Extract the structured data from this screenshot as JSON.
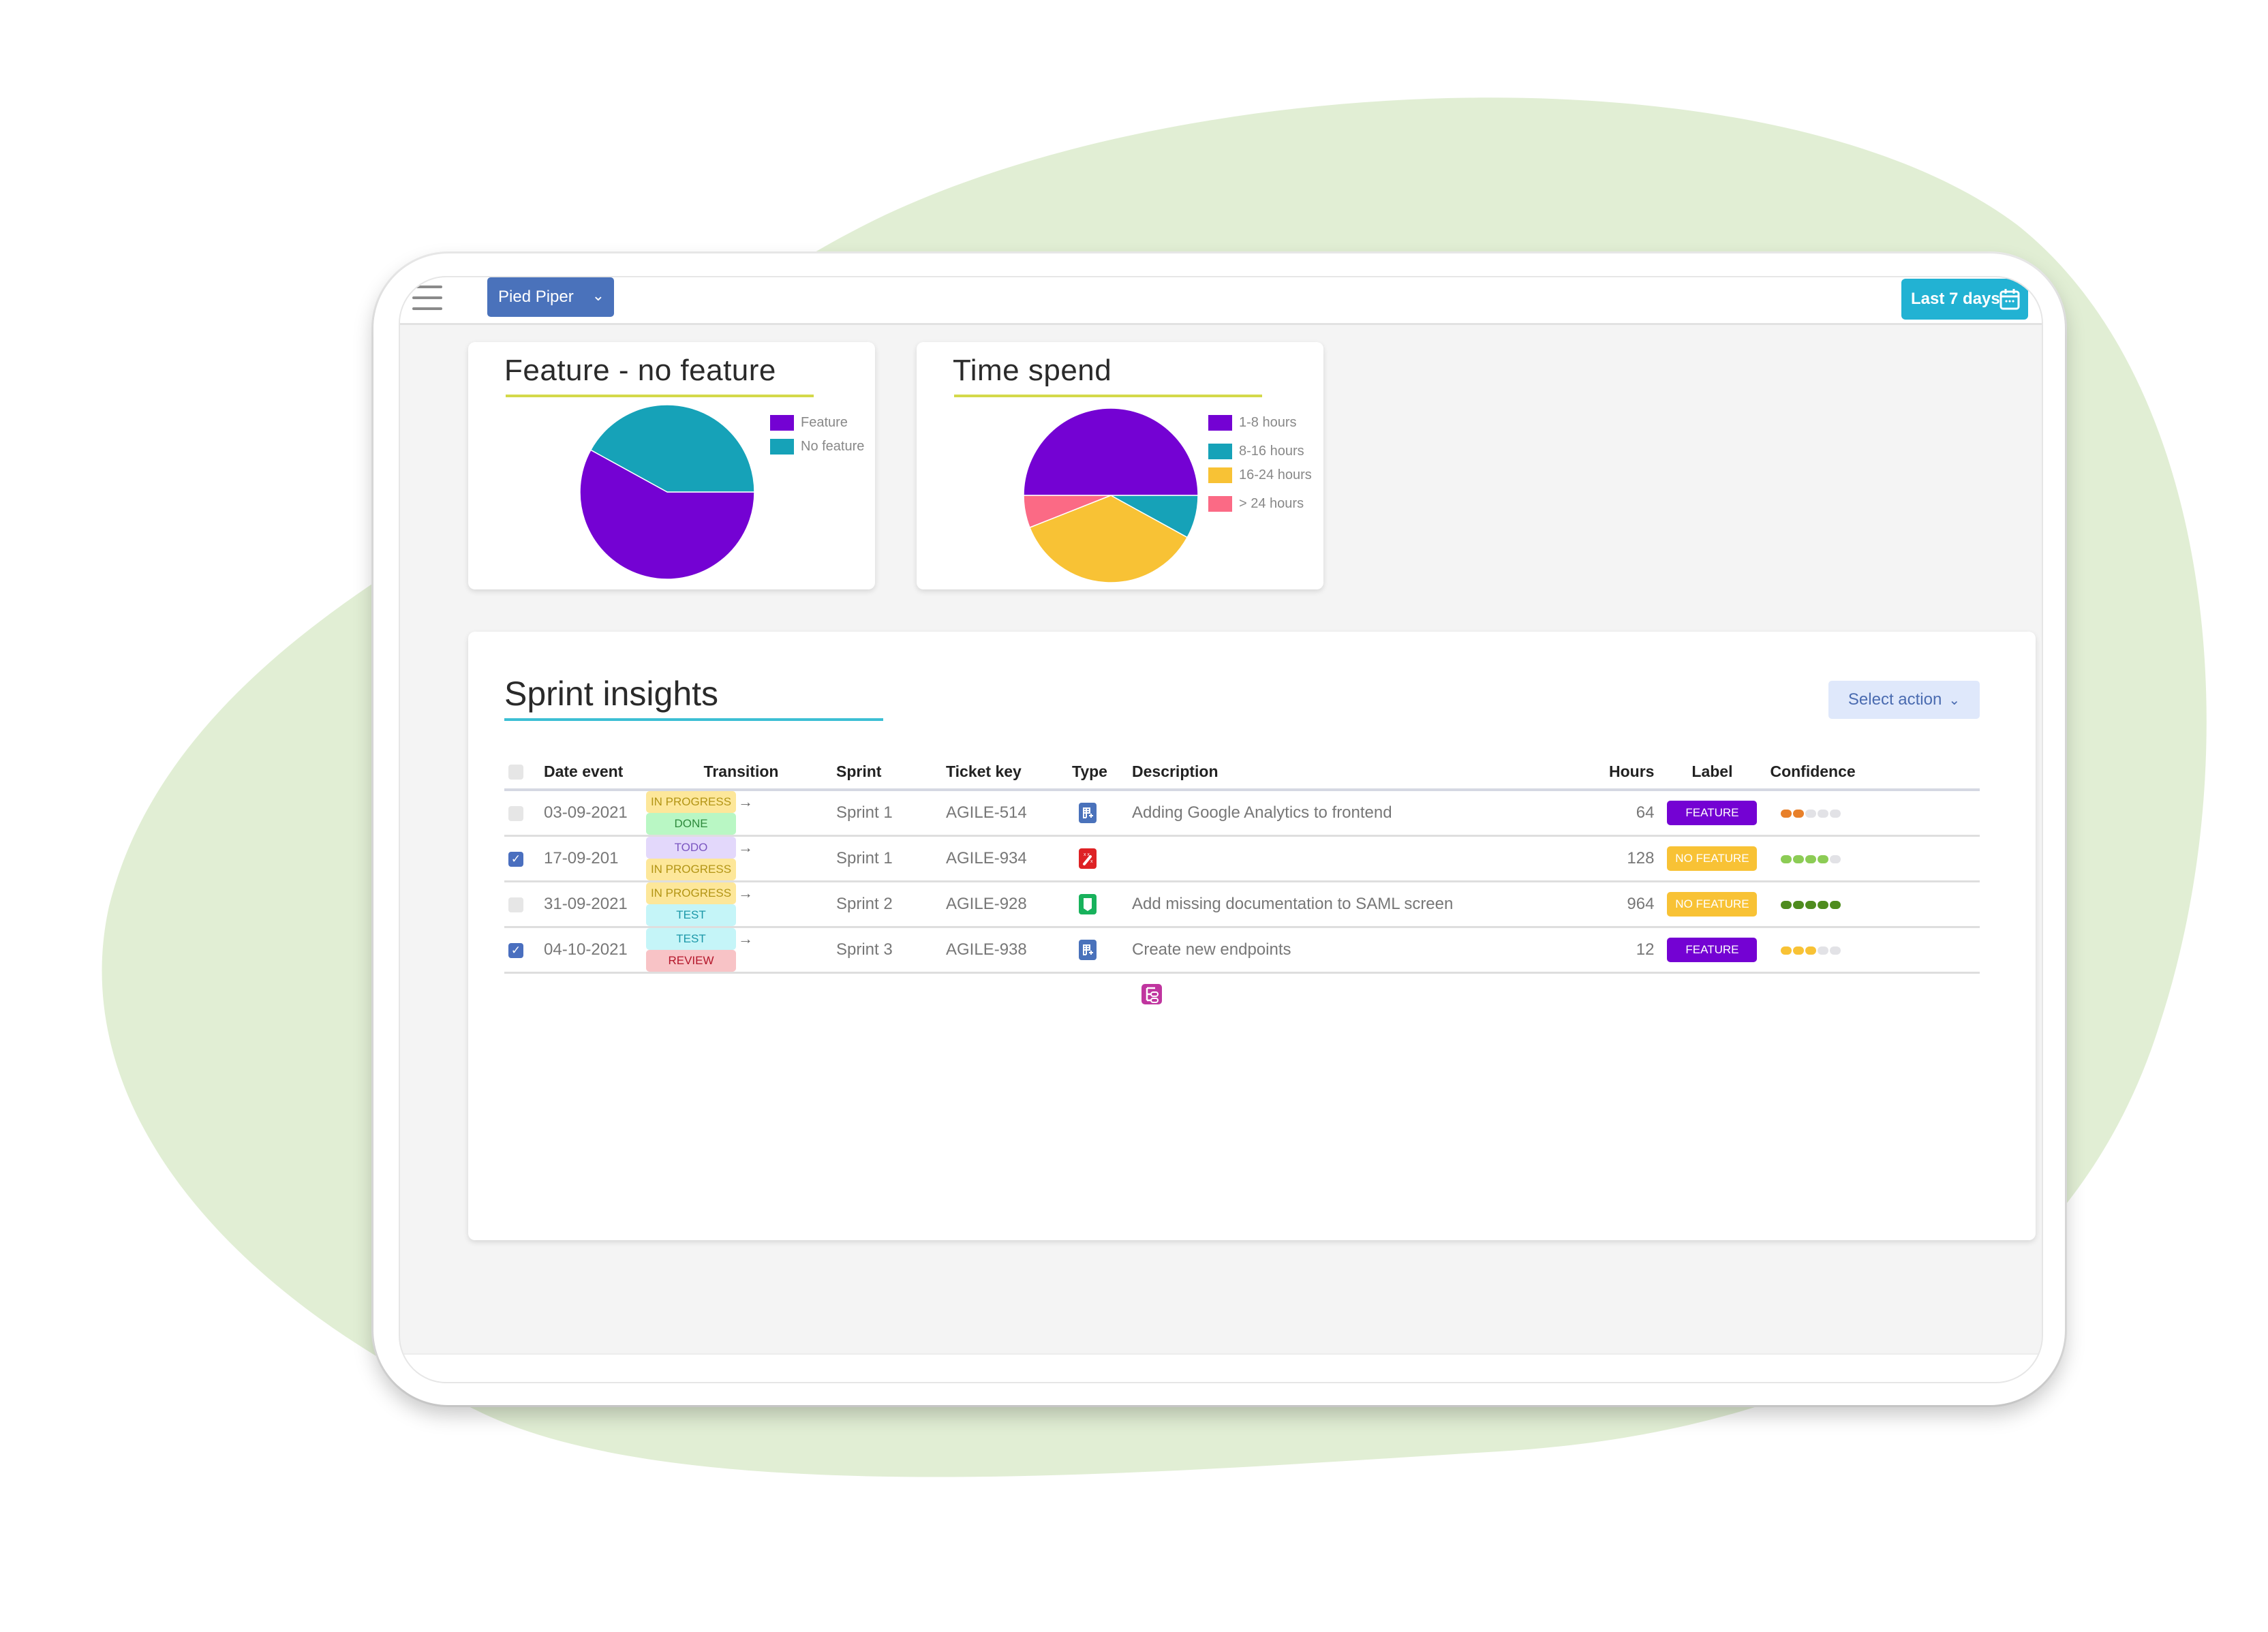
{
  "header": {
    "menu_icon": "hamburger-menu-icon",
    "project_selector": {
      "label": "Pied Piper",
      "icon": "chevron-down-icon"
    },
    "date_range": {
      "label": "Last 7 days",
      "icon": "calendar-icon"
    }
  },
  "colors": {
    "feature": "#7402d3",
    "no_feature": "#16a2b8",
    "h1_8": "#7402d3",
    "h8_16": "#16a2b8",
    "h16_24": "#f8c235",
    "h24_plus": "#fb6a85",
    "primary_button": "#4a72bb",
    "date_button": "#22b2d3",
    "title_underline": "#d4d94a",
    "sprint_underline": "#3cbfd4"
  },
  "chart_data": [
    {
      "type": "pie",
      "title": "Feature - no feature",
      "legend_position": "right",
      "categories": [
        "Feature",
        "No feature"
      ],
      "values": [
        58,
        42
      ],
      "colors": [
        "#7402d3",
        "#16a2b8"
      ]
    },
    {
      "type": "pie",
      "title": "Time spend",
      "legend_position": "right",
      "categories": [
        "1-8 hours",
        "8-16 hours",
        "16-24 hours",
        "> 24 hours"
      ],
      "values": [
        50,
        8,
        36,
        6
      ],
      "colors": [
        "#7402d3",
        "#16a2b8",
        "#f8c235",
        "#fb6a85"
      ]
    }
  ],
  "sprint_insights": {
    "title": "Sprint insights",
    "select_action": "Select action",
    "columns": [
      "Date event",
      "Transition",
      "Sprint",
      "Ticket key",
      "Type",
      "Description",
      "Hours",
      "Label",
      "Confidence"
    ],
    "rows": [
      {
        "checked": false,
        "date": "03-09-2021",
        "from": "IN PROGRESS",
        "to": "DONE",
        "sprint": "Sprint 1",
        "ticket": "AGILE-514",
        "type": "story-icon",
        "description": "Adding Google Analytics to frontend",
        "hours": "64",
        "label": "FEATURE",
        "confidence": 2,
        "confidence_color": "#e8802a"
      },
      {
        "checked": true,
        "date": "17-09-201",
        "from": "TODO",
        "to": "IN PROGRESS",
        "sprint": "Sprint 1",
        "ticket": "AGILE-934",
        "type": "bug-magic-wand-icon",
        "description": "",
        "hours": "128",
        "label": "NO FEATURE",
        "confidence": 4,
        "confidence_color": "#8ccc55"
      },
      {
        "checked": false,
        "date": "31-09-2021",
        "from": "IN PROGRESS",
        "to": "TEST",
        "sprint": "Sprint 2",
        "ticket": "AGILE-928",
        "type": "documentation-icon",
        "description": "Add missing documentation to SAML screen",
        "hours": "964",
        "label": "NO FEATURE",
        "confidence": 5,
        "confidence_color": "#4e8c1e"
      },
      {
        "checked": true,
        "date": "04-10-2021",
        "from": "TEST",
        "to": "REVIEW",
        "sprint": "Sprint 3",
        "ticket": "AGILE-938",
        "type": "story-icon",
        "description": "Create new endpoints",
        "hours": "12",
        "label": "FEATURE",
        "confidence": 3,
        "confidence_color": "#f8c235"
      }
    ],
    "footer_icon": "tree-structure-icon"
  }
}
